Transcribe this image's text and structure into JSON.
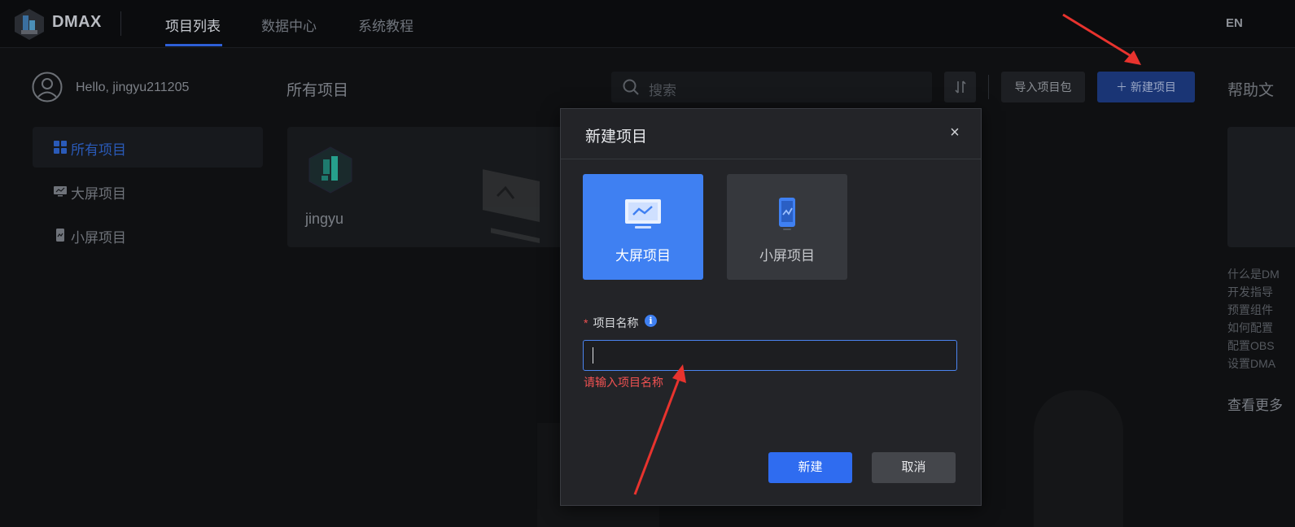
{
  "topbar": {
    "brand": "DMAX",
    "tabs": [
      {
        "label": "项目列表",
        "active": true
      },
      {
        "label": "数据中心",
        "active": false
      },
      {
        "label": "系统教程",
        "active": false
      }
    ],
    "lang": "EN"
  },
  "user": {
    "greeting": "Hello, jingyu211205"
  },
  "sidebar": {
    "items": [
      {
        "label": "所有项目",
        "icon": "grid-icon",
        "active": true
      },
      {
        "label": "大屏项目",
        "icon": "monitor-icon",
        "active": false
      },
      {
        "label": "小屏项目",
        "icon": "mobile-icon",
        "active": false
      }
    ]
  },
  "main": {
    "title": "所有项目",
    "search_placeholder": "搜索",
    "import_label": "导入项目包",
    "new_label": "＋  新建项目",
    "projects": [
      {
        "name": "jingyu"
      }
    ]
  },
  "help": {
    "title": "帮助文",
    "items": [
      "什么是DM",
      "开发指导",
      "预置组件",
      "如何配置",
      "配置OBS",
      "设置DMA"
    ],
    "more": "查看更多"
  },
  "modal": {
    "title": "新建项目",
    "close": "×",
    "types": [
      {
        "label": "大屏项目",
        "icon": "monitor-icon",
        "selected": true
      },
      {
        "label": "小屏项目",
        "icon": "mobile-icon",
        "selected": false
      }
    ],
    "field_required": "*",
    "field_label": "项目名称",
    "field_info": "i",
    "field_value": "",
    "error": "请输入项目名称",
    "create_label": "新建",
    "cancel_label": "取消"
  },
  "colors": {
    "accent": "#3f80f2",
    "error": "#f05252",
    "annotation": "#e8332e"
  }
}
